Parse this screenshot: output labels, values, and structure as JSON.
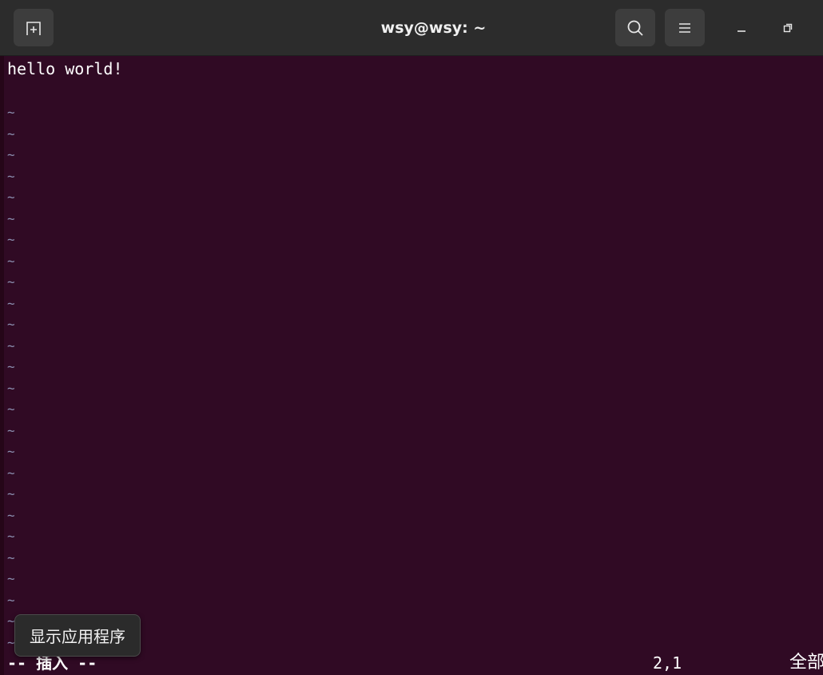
{
  "window": {
    "title": "wsy@wsy: ~",
    "icons": {
      "new_tab": "new-tab-icon",
      "search": "search-icon",
      "menu": "hamburger-menu-icon",
      "minimize": "minimize-icon",
      "maximize": "maximize-icon"
    }
  },
  "editor": {
    "lines": [
      "hello world!",
      ""
    ],
    "empty_line_marker": "~",
    "empty_line_count": 26
  },
  "statusbar": {
    "mode": "-- 插入 --",
    "cursor_position": "2,1",
    "scroll_position": "全部"
  },
  "tooltip": {
    "text": "显示应用程序"
  },
  "colors": {
    "terminal_background": "#300a24",
    "titlebar_background": "#2c2c2c",
    "tilde_color": "#8c8fb0",
    "text_color": "#ffffff"
  }
}
